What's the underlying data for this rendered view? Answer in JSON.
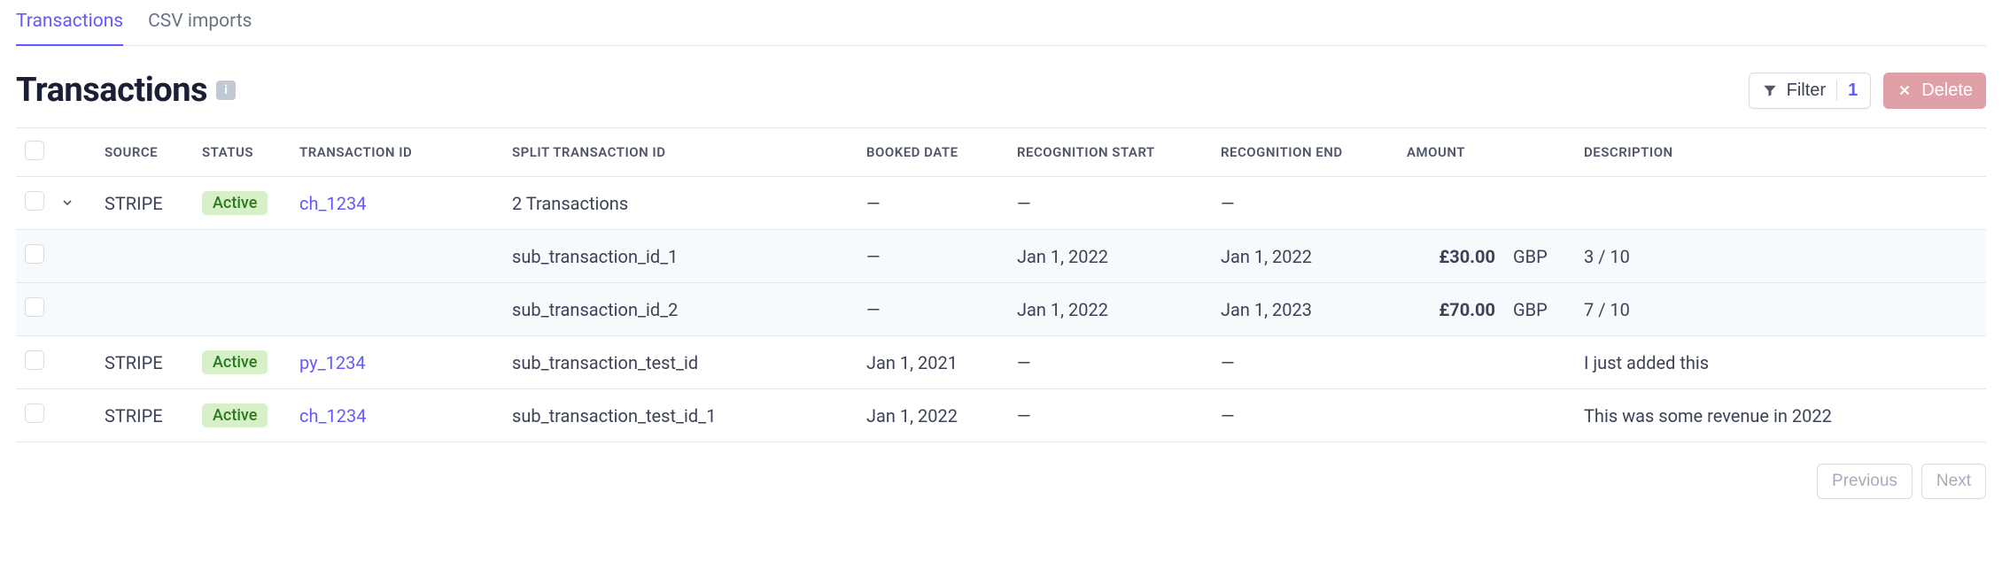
{
  "tabs": [
    {
      "label": "Transactions",
      "active": true
    },
    {
      "label": "CSV imports",
      "active": false
    }
  ],
  "header": {
    "title": "Transactions",
    "filter_label": "Filter",
    "filter_count": "1",
    "delete_label": "Delete"
  },
  "columns": {
    "source": "SOURCE",
    "status": "STATUS",
    "txid": "TRANSACTION ID",
    "split": "SPLIT TRANSACTION ID",
    "booked": "BOOKED DATE",
    "recstart": "RECOGNITION START",
    "recend": "RECOGNITION END",
    "amount": "AMOUNT",
    "desc": "DESCRIPTION"
  },
  "rows": [
    {
      "type": "parent",
      "expanded": true,
      "source": "STRIPE",
      "status": "Active",
      "txid": "ch_1234",
      "split": "2 Transactions",
      "booked": "—",
      "recstart": "—",
      "recend": "—",
      "amount": "",
      "currency": "",
      "desc": ""
    },
    {
      "type": "sub",
      "source": "",
      "status": "",
      "txid": "",
      "split": "sub_transaction_id_1",
      "booked": "—",
      "recstart": "Jan 1, 2022",
      "recend": "Jan 1, 2022",
      "amount": "£30.00",
      "currency": "GBP",
      "desc": "3 / 10"
    },
    {
      "type": "sub",
      "source": "",
      "status": "",
      "txid": "",
      "split": "sub_transaction_id_2",
      "booked": "—",
      "recstart": "Jan 1, 2022",
      "recend": "Jan 1, 2023",
      "amount": "£70.00",
      "currency": "GBP",
      "desc": "7 / 10"
    },
    {
      "type": "normal",
      "source": "STRIPE",
      "status": "Active",
      "txid": "py_1234",
      "split": "sub_transaction_test_id",
      "booked": "Jan 1, 2021",
      "recstart": "—",
      "recend": "—",
      "amount": "",
      "currency": "",
      "desc": "I just added this"
    },
    {
      "type": "normal",
      "source": "STRIPE",
      "status": "Active",
      "txid": "ch_1234",
      "split": "sub_transaction_test_id_1",
      "booked": "Jan 1, 2022",
      "recstart": "—",
      "recend": "—",
      "amount": "",
      "currency": "",
      "desc": "This was some revenue in 2022"
    }
  ],
  "pagination": {
    "prev": "Previous",
    "next": "Next"
  }
}
